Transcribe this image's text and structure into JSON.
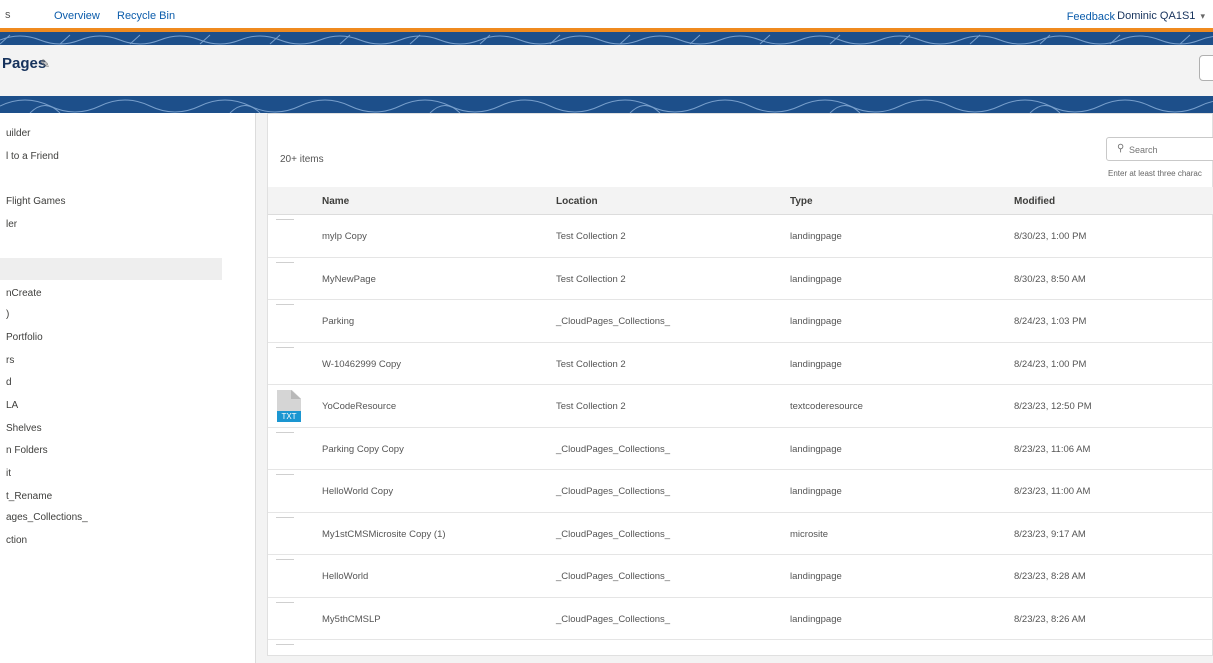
{
  "topbar": {
    "cut_label": "s",
    "tabs": [
      {
        "label": "Overview",
        "active": true
      },
      {
        "label": "Recycle Bin",
        "active": false
      }
    ],
    "feedback_label": "Feedback",
    "user_name": "Dominic QA1S1",
    "user_caret": "▾"
  },
  "header": {
    "title": "Pages",
    "edit_icon": "✎"
  },
  "sidebar": {
    "items": [
      {
        "label": "uilder"
      },
      {
        "label": "l to a Friend"
      },
      {
        "label": "Flight Games"
      },
      {
        "label": "ler"
      },
      {
        "label": "nCreate"
      },
      {
        "label": ")"
      },
      {
        "label": "Portfolio"
      },
      {
        "label": "rs"
      },
      {
        "label": "d"
      },
      {
        "label": "LA"
      },
      {
        "label": "Shelves"
      },
      {
        "label": "n Folders"
      },
      {
        "label": "it"
      },
      {
        "label": "t_Rename"
      },
      {
        "label": "ages_Collections_"
      },
      {
        "label": "ction"
      }
    ]
  },
  "list": {
    "count": "20+ items",
    "search_placeholder": "Search",
    "search_icon": "⚲",
    "search_hint": "Enter at least three charac",
    "columns": {
      "name": "Name",
      "location": "Location",
      "type": "Type",
      "modified": "Modified"
    },
    "rows": [
      {
        "name": "mylp Copy",
        "location": "Test Collection 2",
        "type": "landingpage",
        "modified": "8/30/23, 1:00 PM",
        "icon": "thumb"
      },
      {
        "name": "MyNewPage",
        "location": "Test Collection 2",
        "type": "landingpage",
        "modified": "8/30/23, 8:50 AM",
        "icon": "thumb"
      },
      {
        "name": "Parking",
        "location": "_CloudPages_Collections_",
        "type": "landingpage",
        "modified": "8/24/23, 1:03 PM",
        "icon": "thumb"
      },
      {
        "name": "W-10462999 Copy",
        "location": "Test Collection 2",
        "type": "landingpage",
        "modified": "8/24/23, 1:00 PM",
        "icon": "thumb"
      },
      {
        "name": "YoCodeResource",
        "location": "Test Collection 2",
        "type": "textcoderesource",
        "modified": "8/23/23, 12:50 PM",
        "icon": "txt-file-icon",
        "icon_label": "TXT"
      },
      {
        "name": "Parking Copy Copy",
        "location": "_CloudPages_Collections_",
        "type": "landingpage",
        "modified": "8/23/23, 11:06 AM",
        "icon": "thumb"
      },
      {
        "name": "HelloWorld Copy",
        "location": "_CloudPages_Collections_",
        "type": "landingpage",
        "modified": "8/23/23, 11:00 AM",
        "icon": "thumb"
      },
      {
        "name": "My1stCMSMicrosite Copy (1)",
        "location": "_CloudPages_Collections_",
        "type": "microsite",
        "modified": "8/23/23, 9:17 AM",
        "icon": "thumb"
      },
      {
        "name": "HelloWorld",
        "location": "_CloudPages_Collections_",
        "type": "landingpage",
        "modified": "8/23/23, 8:28 AM",
        "icon": "thumb"
      },
      {
        "name": "My5thCMSLP",
        "location": "_CloudPages_Collections_",
        "type": "landingpage",
        "modified": "8/23/23, 8:26 AM",
        "icon": "thumb"
      }
    ]
  },
  "colors": {
    "accent": "#0b5cab",
    "banner": "#1d4f8a",
    "orange": "#ef8a1f",
    "txt_badge": "#1b96d1"
  }
}
